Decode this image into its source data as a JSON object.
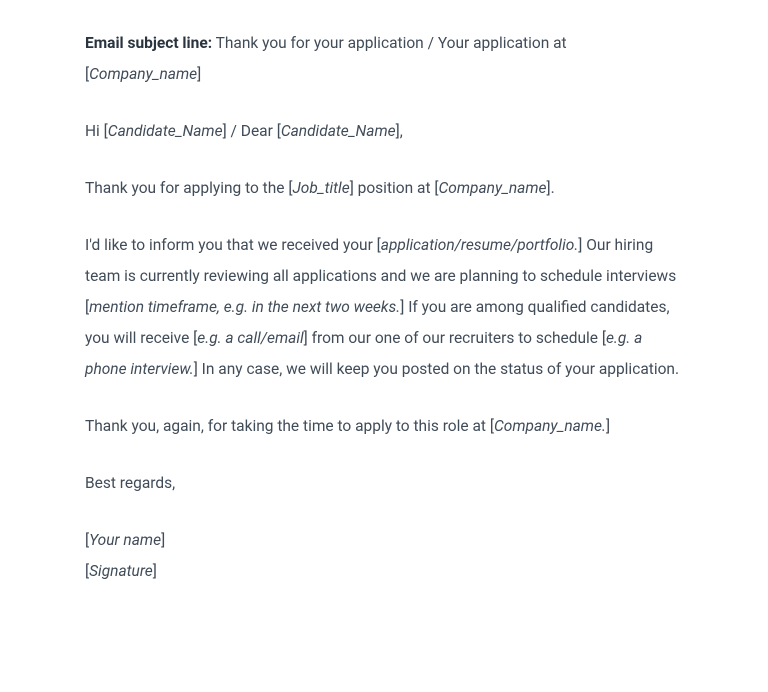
{
  "subject": {
    "label": "Email subject line:",
    "text_before": " Thank you for your application / Your application at [",
    "placeholder": "Company_name",
    "text_after": "]"
  },
  "greeting": {
    "t1": "Hi [",
    "p1": "Candidate_Name",
    "t2": "] / Dear [",
    "p2": "Candidate_Name",
    "t3": "],"
  },
  "para1": {
    "t1": "Thank you for applying to the [",
    "p1": "Job_title",
    "t2": "] position at [",
    "p2": "Company_name",
    "t3": "]."
  },
  "para2": {
    "t1": "I'd like to inform you that we received your [",
    "p1": "application/resume/portfolio.",
    "t2": "] Our hiring team is currently reviewing all applications and we are planning to schedule interviews [",
    "p2": "mention timeframe, e.g. in the next two weeks.",
    "t3": "] If you are among qualified candidates, you will receive [",
    "p3": "e.g. a call/email",
    "t4": "] from our one of our recruiters to schedule [",
    "p4": "e.g. a phone interview.",
    "t5": "] In any case, we will keep you posted on the status of your application."
  },
  "para3": {
    "t1": "Thank you, again, for taking the time to apply to this role at [",
    "p1": "Company_name.",
    "t2": "]"
  },
  "closing": "Best regards,",
  "signature": {
    "t1": "[",
    "p1": "Your name",
    "t2": "]",
    "t3": "[",
    "p2": "Signature",
    "t4": "]"
  }
}
